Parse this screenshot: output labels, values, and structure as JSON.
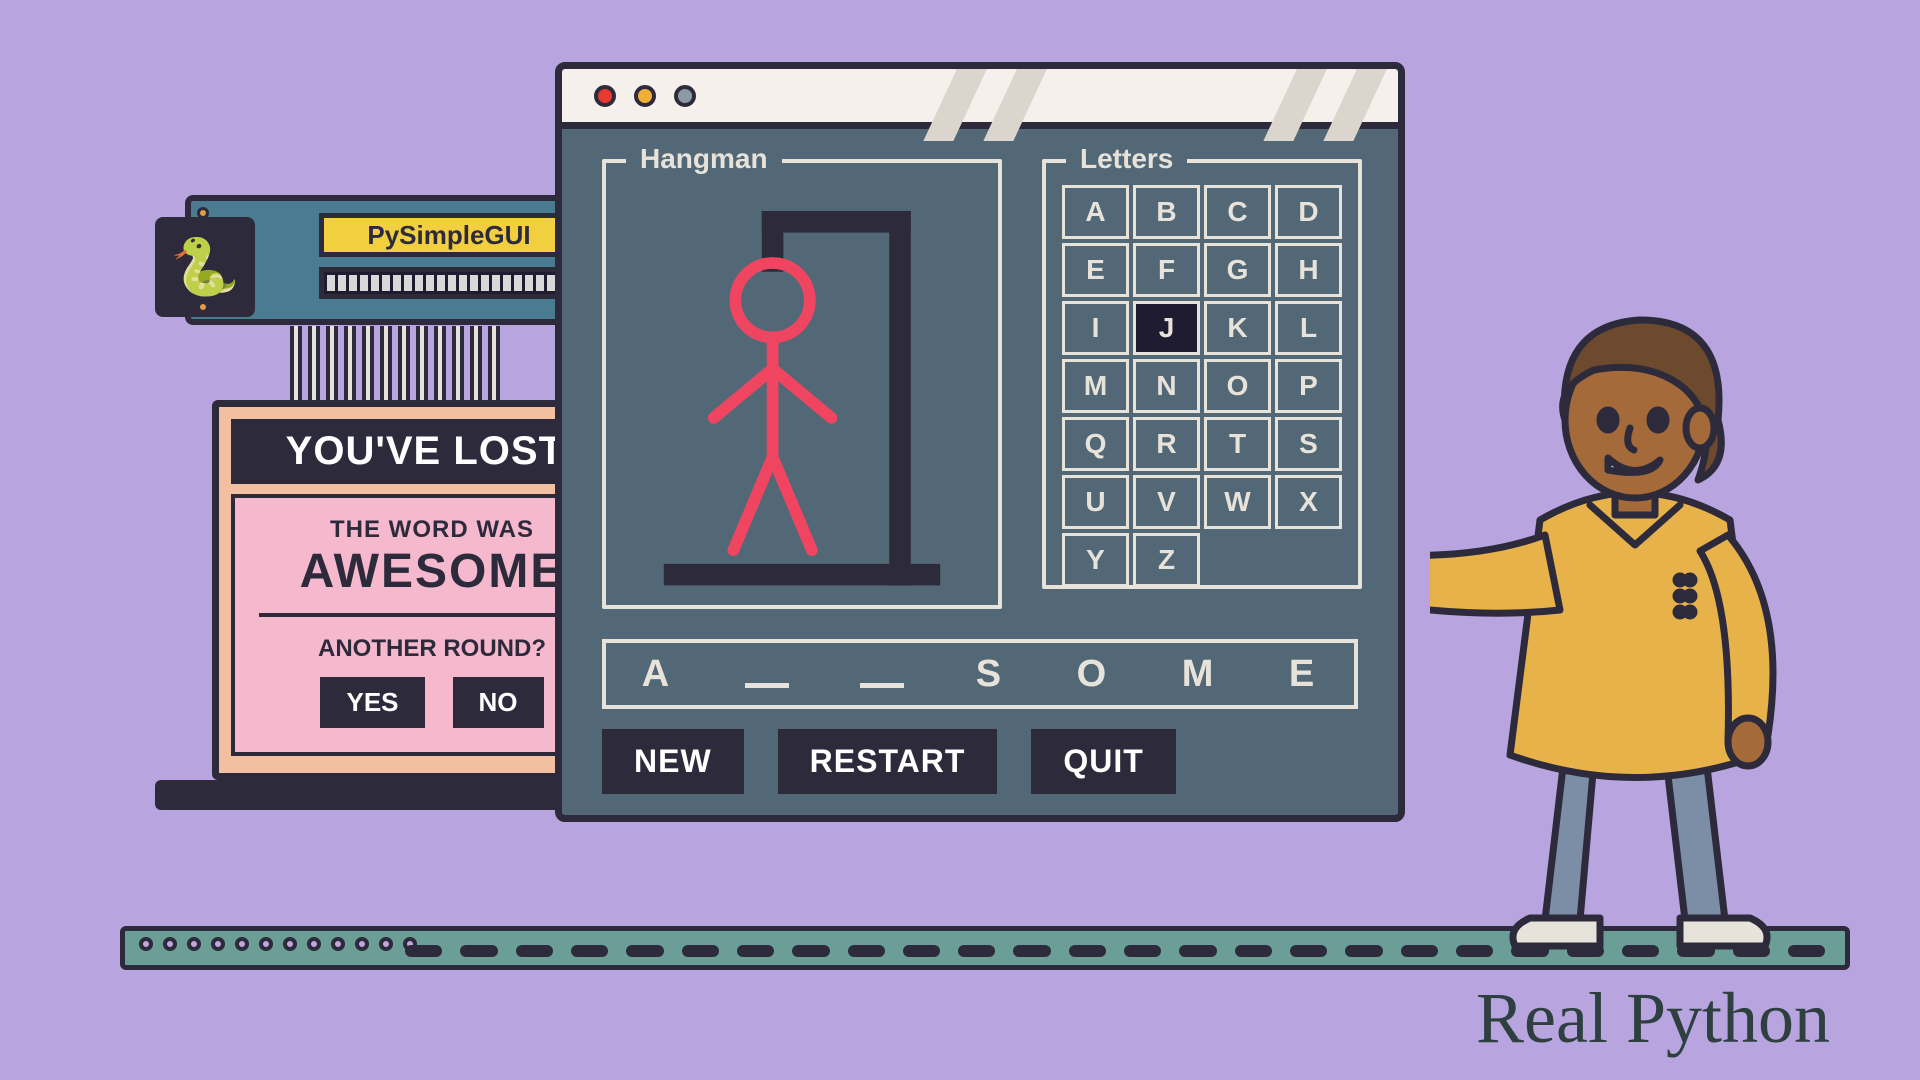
{
  "brand": "Real Python",
  "chip": {
    "label": "PySimpleGUI"
  },
  "result": {
    "title": "YOU'VE LOST!",
    "subtitle": "THE WORD WAS",
    "word": "AWESOME",
    "prompt": "ANOTHER ROUND?",
    "yes": "YES",
    "no": "NO"
  },
  "panels": {
    "hangman": "Hangman",
    "letters": "Letters"
  },
  "letters": {
    "alphabet": [
      "A",
      "B",
      "C",
      "D",
      "E",
      "F",
      "G",
      "H",
      "I",
      "J",
      "K",
      "L",
      "M",
      "N",
      "O",
      "P",
      "Q",
      "R",
      "T",
      "S",
      "U",
      "V",
      "W",
      "X",
      "Y",
      "Z"
    ],
    "selected": "J"
  },
  "guess": [
    "A",
    "_",
    "_",
    "S",
    "O",
    "M",
    "E"
  ],
  "controls": {
    "new": "NEW",
    "restart": "RESTART",
    "quit": "QUIT"
  },
  "colors": {
    "app": "#536876",
    "dark": "#2d2b3b",
    "accent": "#e43b2e"
  }
}
